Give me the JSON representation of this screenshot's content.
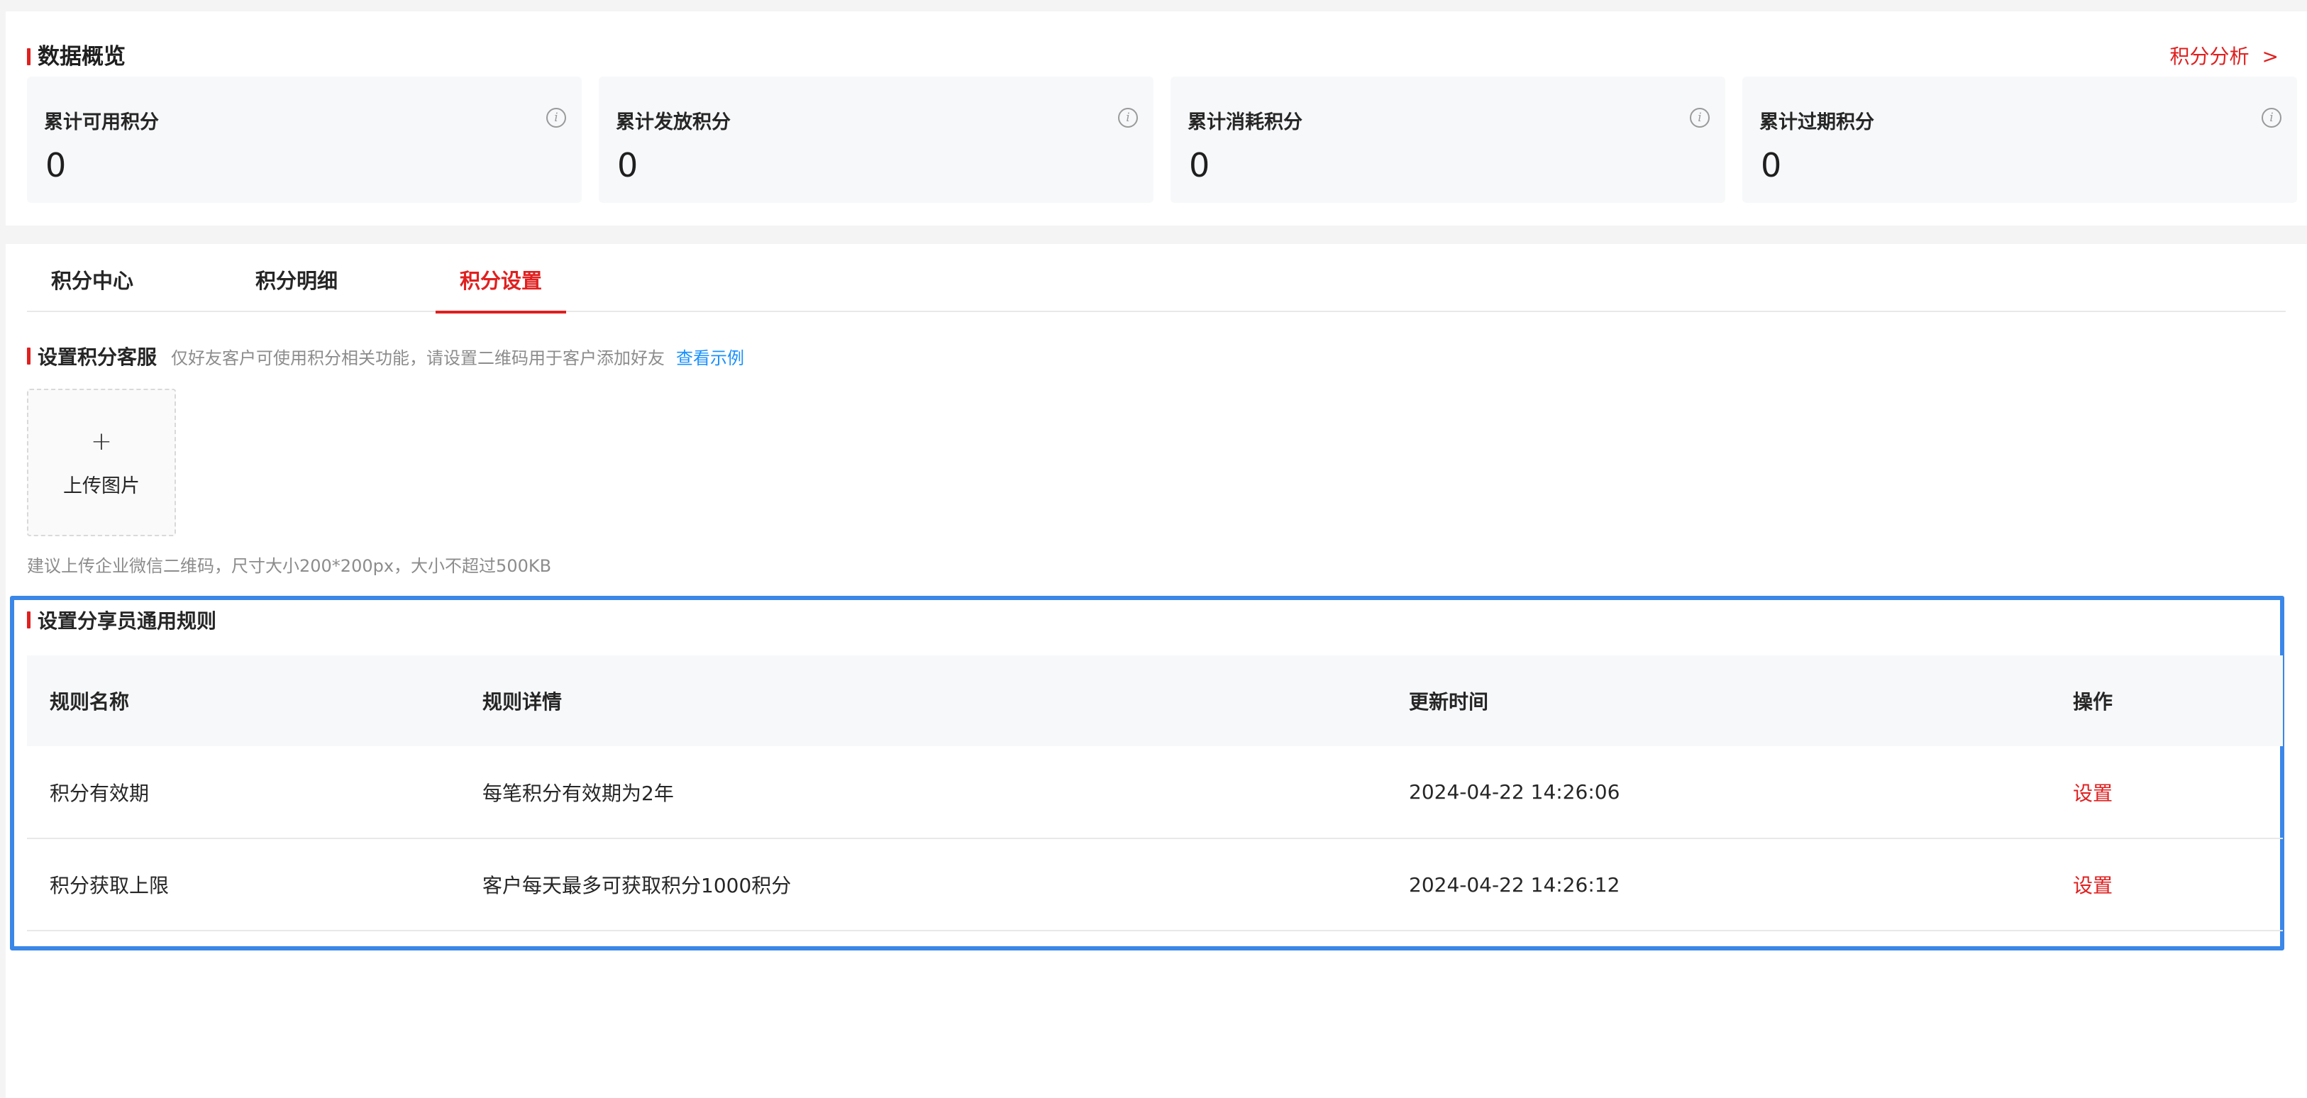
{
  "overview": {
    "title": "数据概览",
    "analysis_link": "积分分析",
    "analysis_chevron": ">",
    "cards": [
      {
        "label": "累计可用积分",
        "value": "0",
        "icon": "info-icon"
      },
      {
        "label": "累计发放积分",
        "value": "0",
        "icon": "info-icon"
      },
      {
        "label": "累计消耗积分",
        "value": "0",
        "icon": "info-icon"
      },
      {
        "label": "累计过期积分",
        "value": "0",
        "icon": "info-icon"
      }
    ]
  },
  "tabs": [
    {
      "label": "积分中心",
      "active": false
    },
    {
      "label": "积分明细",
      "active": false
    },
    {
      "label": "积分设置",
      "active": true
    }
  ],
  "kefu": {
    "title": "设置积分客服",
    "desc": "仅好友客户可使用积分相关功能，请设置二维码用于客户添加好友",
    "example_link": "查看示例",
    "upload_plus": "+",
    "upload_label": "上传图片",
    "hint": "建议上传企业微信二维码，尺寸大小200*200px，大小不超过500KB"
  },
  "rules": {
    "title": "设置分享员通用规则",
    "columns": [
      "规则名称",
      "规则详情",
      "更新时间",
      "操作"
    ],
    "rows": [
      {
        "name": "积分有效期",
        "detail": "每笔积分有效期为2年",
        "updated": "2024-04-22 14:26:06",
        "action": "设置"
      },
      {
        "name": "积分获取上限",
        "detail": "客户每天最多可获取积分1000积分",
        "updated": "2024-04-22 14:26:12",
        "action": "设置"
      }
    ]
  },
  "colors": {
    "accent": "#e02020",
    "link": "#1890ff",
    "highlight_frame": "#3a87e8"
  }
}
